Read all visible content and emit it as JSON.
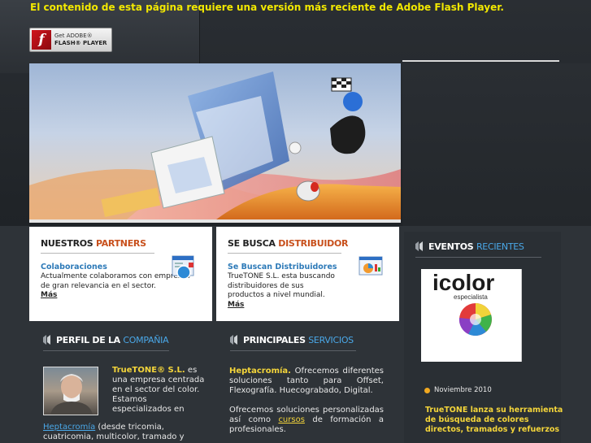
{
  "flash": {
    "message": "El contenido de esta página requiere una versión más reciente de Adobe Flash Player.",
    "badge_line1": "Get ADOBE®",
    "badge_line2": "FLASH® PLAYER",
    "badge_icon": "f"
  },
  "partners": {
    "title_plain": "NUESTROS",
    "title_accent": "PARTNERS",
    "subtitle": "Colaboraciones",
    "body": "Actualmente colaboramos con empresas de gran relevancia en el sector.",
    "more": "Más"
  },
  "distribuidor": {
    "title_plain": "SE BUSCA",
    "title_accent": "DISTRIBUIDOR",
    "subtitle": "Se Buscan Distribuidores",
    "body": "TrueTONE S.L. esta buscando distribuidores de sus productos a nivel mundial.",
    "more": "Más"
  },
  "profile": {
    "title_plain": "PERFIL DE LA",
    "title_accent": "COMPAÑIA",
    "brand": "TrueTONE® S.L.",
    "text": " es una empresa centrada en el sector del color. Estamos especializados en",
    "link": "Heptacromía",
    "more": " (desde tricomia, cuatricomia, multicolor, tramado y"
  },
  "services": {
    "title_plain": "PRINCIPALES",
    "title_accent": "SERVICIOS",
    "hl": "Heptacromía.",
    "p1": " Ofrecemos diferentes soluciones tanto para Offset, Flexografía. Huecograbado, Digital.",
    "p2a": "Ofrecemos soluciones personalizadas así como ",
    "p2link": "cursos",
    "p2b": " de formación a profesionales."
  },
  "events": {
    "title_plain": "EVENTOS",
    "title_accent": "RECIENTES",
    "logo_text": "icolor",
    "logo_sub": "especialista",
    "date": "Noviembre 2010",
    "headline": "TrueTONE lanza su herramienta de búsqueda de colores directos, tramados y refuerzos"
  },
  "colors": {
    "flash_yellow": "#f2e800",
    "accent_orange": "#c8501c",
    "accent_blue": "#4aa8e8",
    "link_blue": "#2d7ab8",
    "highlight_yellow": "#f4d53a"
  }
}
